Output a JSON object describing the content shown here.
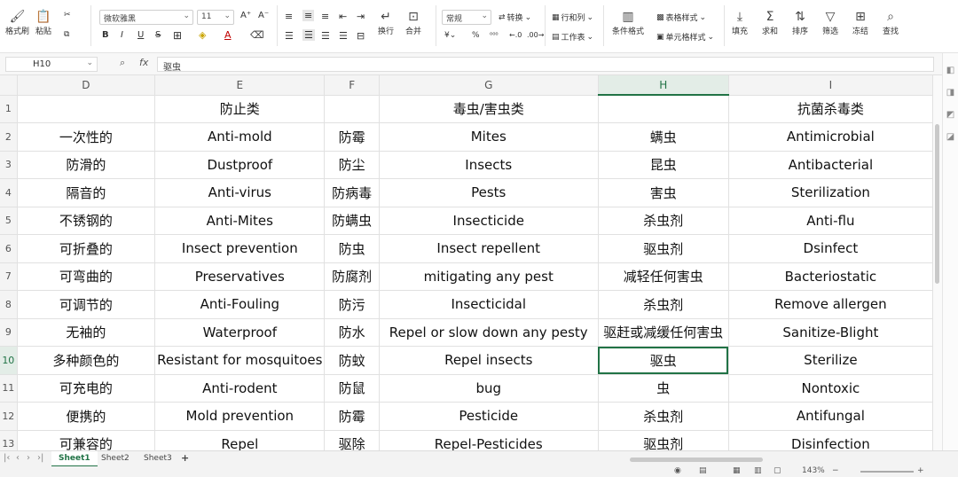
{
  "ribbon": {
    "format_painter": "格式刷",
    "paste": "粘贴",
    "font_name": "微软雅黑",
    "font_size": "11",
    "bold": "B",
    "italic": "I",
    "underline": "U",
    "strike": "S",
    "font_color_glyph": "A",
    "wrap": "换行",
    "merge": "合并",
    "number_format": "常规",
    "convert": "转换",
    "row_col": "行和列",
    "worksheet": "工作表",
    "percent": "%",
    "cond_format": "条件格式",
    "table_style": "表格样式",
    "cell_style": "单元格样式",
    "fill": "填充",
    "sum": "求和",
    "sort": "排序",
    "filter": "筛选",
    "freeze": "冻结",
    "find": "查找"
  },
  "formula_bar": {
    "cell_ref": "H10",
    "fx": "fx",
    "content": "驱虫"
  },
  "grid": {
    "columns": [
      "D",
      "E",
      "F",
      "G",
      "H",
      "I"
    ],
    "selected_column": "H",
    "selected_row": "10",
    "rows": [
      {
        "n": "1",
        "cells": [
          "",
          "防止类",
          "",
          "毒虫/害虫类",
          "",
          "抗菌杀毒类"
        ]
      },
      {
        "n": "2",
        "cells": [
          "一次性的",
          "Anti-mold",
          "防霉",
          "Mites",
          "螨虫",
          "Antimicrobial"
        ]
      },
      {
        "n": "3",
        "cells": [
          "防滑的",
          "Dustproof",
          "防尘",
          "Insects",
          "昆虫",
          "Antibacterial"
        ]
      },
      {
        "n": "4",
        "cells": [
          "隔音的",
          "Anti-virus",
          "防病毒",
          "Pests",
          "害虫",
          "Sterilization"
        ]
      },
      {
        "n": "5",
        "cells": [
          "不锈钢的",
          "Anti-Mites",
          "防螨虫",
          "Insecticide",
          "杀虫剂",
          "Anti-flu"
        ]
      },
      {
        "n": "6",
        "cells": [
          "可折叠的",
          "Insect prevention",
          "防虫",
          "Insect repellent",
          "驱虫剂",
          "Dsinfect"
        ]
      },
      {
        "n": "7",
        "cells": [
          "可弯曲的",
          "Preservatives",
          "防腐剂",
          "mitigating any pest",
          "减轻任何害虫",
          "Bacteriostatic"
        ]
      },
      {
        "n": "8",
        "cells": [
          "可调节的",
          "Anti-Fouling",
          "防污",
          "Insecticidal",
          "杀虫剂",
          "Remove allergen"
        ]
      },
      {
        "n": "9",
        "cells": [
          "无袖的",
          "Waterproof",
          "防水",
          "Repel or slow down any pesty",
          "驱赶或减缓任何害虫",
          "Sanitize-Blight"
        ]
      },
      {
        "n": "10",
        "cells": [
          "多种颜色的",
          "Resistant for mosquitoes",
          "防蚊",
          "Repel insects",
          "驱虫",
          "Sterilize"
        ]
      },
      {
        "n": "11",
        "cells": [
          "可充电的",
          "Anti-rodent",
          "防鼠",
          "bug",
          "虫",
          "Nontoxic"
        ]
      },
      {
        "n": "12",
        "cells": [
          "便携的",
          "Mold prevention",
          "防霉",
          "Pesticide",
          "杀虫剂",
          "Antifungal"
        ]
      },
      {
        "n": "13",
        "cells": [
          "可兼容的",
          "Repel",
          "驱除",
          "Repel-Pesticides",
          "驱虫剂",
          "Disinfection"
        ]
      }
    ]
  },
  "sheet_tabs": [
    "Sheet1",
    "Sheet2",
    "Sheet3"
  ],
  "add_sheet": "+",
  "status": {
    "zoom": "143%"
  },
  "colors": {
    "accent": "#217346"
  }
}
